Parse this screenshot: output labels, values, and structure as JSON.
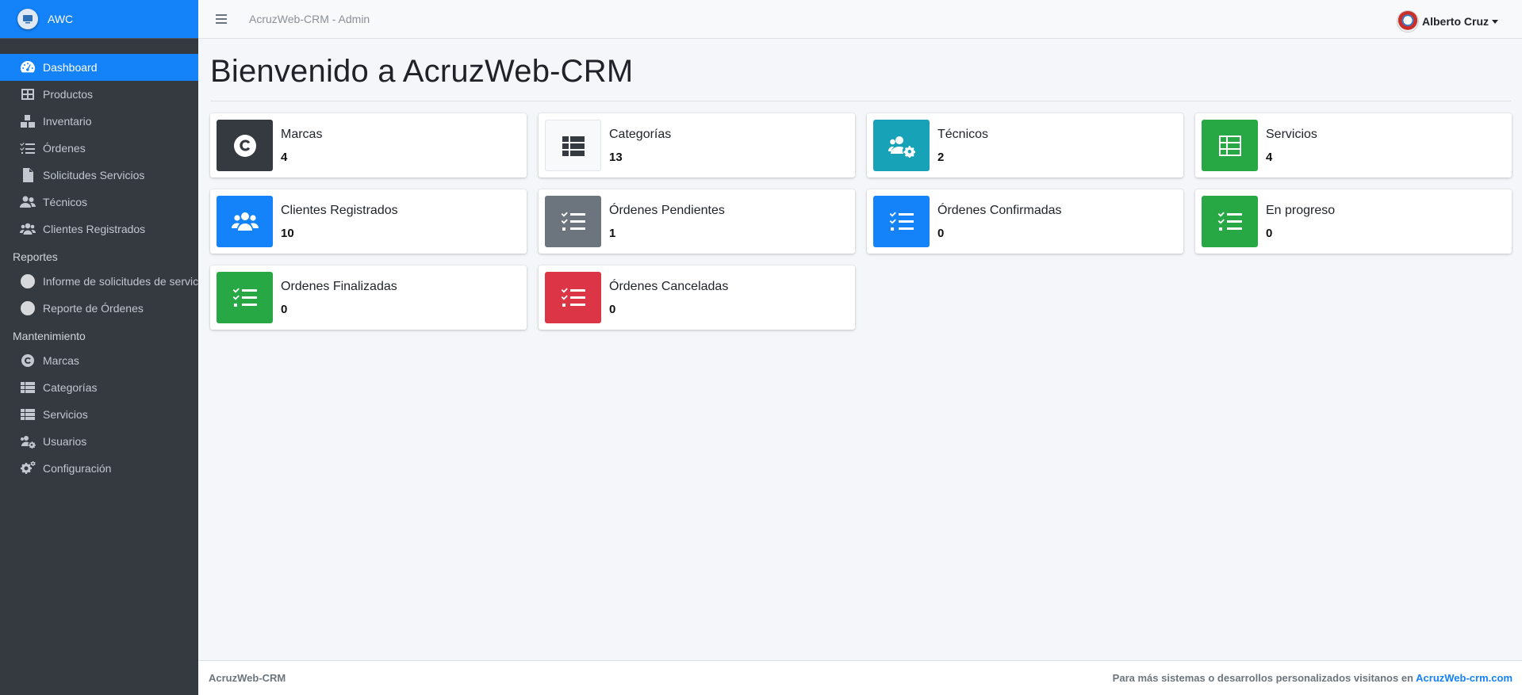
{
  "brand": {
    "name": "AWC"
  },
  "topbar": {
    "title": "AcruzWeb-CRM - Admin",
    "user_name": "Alberto Cruz"
  },
  "sidebar": {
    "items": [
      {
        "label": "Dashboard",
        "icon": "tachometer-icon",
        "active": true
      },
      {
        "label": "Productos",
        "icon": "table-icon"
      },
      {
        "label": "Inventario",
        "icon": "boxes-icon"
      },
      {
        "label": "Órdenes",
        "icon": "list-check-icon"
      },
      {
        "label": "Solicitudes Servicios",
        "icon": "file-icon"
      },
      {
        "label": "Técnicos",
        "icon": "user-friends-icon"
      },
      {
        "label": "Clientes Registrados",
        "icon": "users-icon"
      }
    ],
    "reportes_header": "Reportes",
    "reportes": [
      {
        "label": "Informe de solicitudes de servicios",
        "icon": "circle-icon"
      },
      {
        "label": "Reporte de Órdenes",
        "icon": "circle-icon"
      }
    ],
    "mantenimiento_header": "Mantenimiento",
    "mantenimiento": [
      {
        "label": "Marcas",
        "icon": "copyright-icon"
      },
      {
        "label": "Categorías",
        "icon": "th-list-icon"
      },
      {
        "label": "Servicios",
        "icon": "th-list-icon"
      },
      {
        "label": "Usuarios",
        "icon": "users-cog-icon"
      },
      {
        "label": "Configuración",
        "icon": "cogs-icon"
      }
    ]
  },
  "main": {
    "title": "Bienvenido a AcruzWeb-CRM",
    "boxes": [
      {
        "label": "Marcas",
        "value": "4",
        "color": "#343a40",
        "icon": "copyright-icon"
      },
      {
        "label": "Categorías",
        "value": "13",
        "color": "#f8f9fa",
        "icon": "th-list-icon"
      },
      {
        "label": "Técnicos",
        "value": "2",
        "color": "#17a2b8",
        "icon": "users-cog-icon"
      },
      {
        "label": "Servicios",
        "value": "4",
        "color": "#28a745",
        "icon": "th-icon"
      },
      {
        "label": "Clientes Registrados",
        "value": "10",
        "color": "#1482f8",
        "icon": "users-icon"
      },
      {
        "label": "Órdenes Pendientes",
        "value": "1",
        "color": "#6c757d",
        "icon": "tasks-icon"
      },
      {
        "label": "Órdenes Confirmadas",
        "value": "0",
        "color": "#1482f8",
        "icon": "tasks-icon"
      },
      {
        "label": "En progreso",
        "value": "0",
        "color": "#28a745",
        "icon": "tasks-icon"
      },
      {
        "label": "Ordenes Finalizadas",
        "value": "0",
        "color": "#28a745",
        "icon": "tasks-icon"
      },
      {
        "label": "Órdenes Canceladas",
        "value": "0",
        "color": "#dc3545",
        "icon": "tasks-icon"
      }
    ]
  },
  "footer": {
    "left": "AcruzWeb-CRM",
    "right_text": "Para más sistemas o desarrollos personalizados visitanos en",
    "right_link": "AcruzWeb-crm.com"
  }
}
